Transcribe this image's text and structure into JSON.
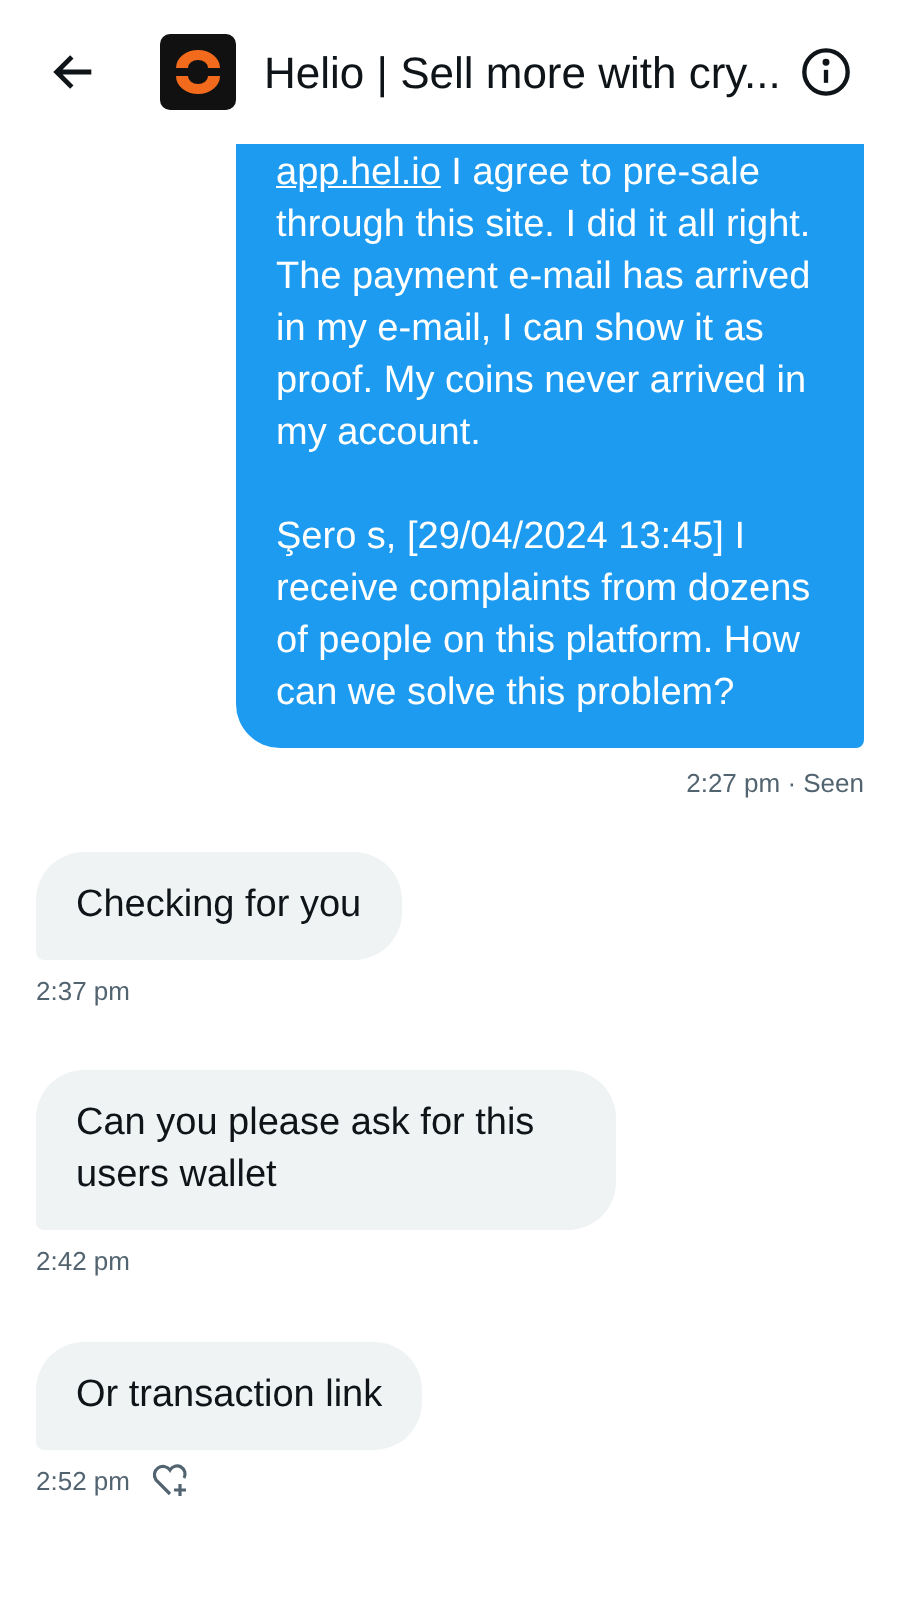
{
  "header": {
    "title": "Helio | Sell more with cry..."
  },
  "sent": {
    "link": "app.hel.io",
    "text": " I agree to pre-sale through this site. I did it all right. The payment e-mail has arrived in my e-mail, I can show it as proof. My coins never arrived in my account.",
    "paragraph_2": "Şero s, [29/04/2024 13:45] I receive complaints from dozens of people on this platform. How can we solve this problem?",
    "meta": "2:27 pm · Seen"
  },
  "received": [
    {
      "text": "Checking for you",
      "time": "2:37 pm",
      "reaction_button": false
    },
    {
      "text": "Can you please ask for this users wallet",
      "time": "2:42 pm",
      "reaction_button": false
    },
    {
      "text": "Or transaction link",
      "time": "2:52 pm",
      "reaction_button": true
    }
  ]
}
